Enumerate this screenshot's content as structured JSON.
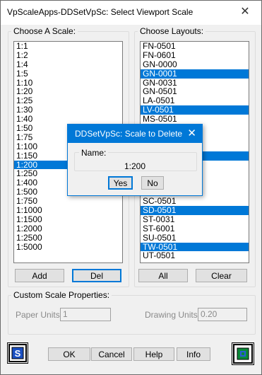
{
  "window": {
    "title": "VpScaleApps-DDSetVpSc: Select Viewport Scale",
    "close_glyph": "✕"
  },
  "scales": {
    "label": "Choose A Scale:",
    "items": [
      "1:1",
      "1:2",
      "1:4",
      "1:5",
      "1:10",
      "1:20",
      "1:25",
      "1:30",
      "1:40",
      "1:50",
      "1:75",
      "1:100",
      "1:150",
      "1:200",
      "1:250",
      "1:400",
      "1:500",
      "1:750",
      "1:1000",
      "1:1500",
      "1:2000",
      "1:2500",
      "1:5000"
    ],
    "selected": "1:200",
    "add_label": "Add",
    "del_label": "Del"
  },
  "layouts": {
    "label": "Choose Layouts:",
    "items": [
      {
        "name": "FN-0501",
        "selected": false
      },
      {
        "name": "FN-0601",
        "selected": false
      },
      {
        "name": "GN-0000",
        "selected": false
      },
      {
        "name": "GN-0001",
        "selected": true
      },
      {
        "name": "GN-0031",
        "selected": false
      },
      {
        "name": "GN-0501",
        "selected": false
      },
      {
        "name": "LA-0501",
        "selected": false
      },
      {
        "name": "LV-0501",
        "selected": true
      },
      {
        "name": "MS-0501",
        "selected": false
      },
      {
        "name": "",
        "selected": false
      },
      {
        "name": "",
        "selected": false
      },
      {
        "name": "",
        "selected": false
      },
      {
        "name": "",
        "selected": true
      },
      {
        "name": "",
        "selected": false
      },
      {
        "name": "",
        "selected": false
      },
      {
        "name": "",
        "selected": false
      },
      {
        "name": "",
        "selected": false
      },
      {
        "name": "SC-0501",
        "selected": false
      },
      {
        "name": "SD-0501",
        "selected": true
      },
      {
        "name": "ST-0031",
        "selected": false
      },
      {
        "name": "ST-6001",
        "selected": false
      },
      {
        "name": "SU-0501",
        "selected": false
      },
      {
        "name": "TW-0501",
        "selected": true
      },
      {
        "name": "UT-0501",
        "selected": false
      }
    ],
    "all_label": "All",
    "clear_label": "Clear"
  },
  "custom": {
    "label": "Custom Scale Properties:",
    "paper_units_label": "Paper Units:",
    "paper_units_value": "1",
    "drawing_units_label": "Drawing Units:",
    "drawing_units_value": "0.20"
  },
  "footer": {
    "ok_label": "OK",
    "cancel_label": "Cancel",
    "help_label": "Help",
    "info_label": "Info"
  },
  "modal": {
    "title": "DDSetVpSc: Scale to Delete",
    "close_glyph": "✕",
    "name_label": "Name:",
    "name_value": "1:200",
    "yes_label": "Yes",
    "no_label": "No"
  },
  "colors": {
    "selection": "#0078d7",
    "window_bg": "#f0f0f0"
  }
}
